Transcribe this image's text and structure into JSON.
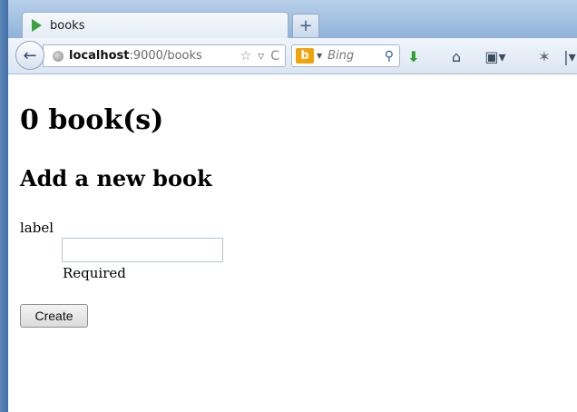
{
  "browser": {
    "tab": {
      "title": "books"
    },
    "new_tab": "+",
    "nav": {
      "back": "←"
    },
    "url": {
      "host": "localhost",
      "path": ":9000/books",
      "icons": [
        "☆",
        "▿",
        "C"
      ]
    },
    "search": {
      "engine_logo": "b",
      "placeholder": "Bing",
      "go": "⚲"
    },
    "toolbar": {
      "download": "⬇",
      "home": "⌂",
      "bookmarks": "▣▾",
      "addon": "✶",
      "menu": "|▾"
    }
  },
  "page": {
    "count_heading": "0 book(s)",
    "add_heading": "Add a new book",
    "form": {
      "label": "label",
      "input_value": "",
      "help": "Required",
      "submit": "Create"
    }
  },
  "colors": {
    "frame": "#3f6ea6",
    "tab_bar": "#b9d1ea",
    "favicon": "#3aa33b",
    "search_logo": "#f0a30a"
  }
}
